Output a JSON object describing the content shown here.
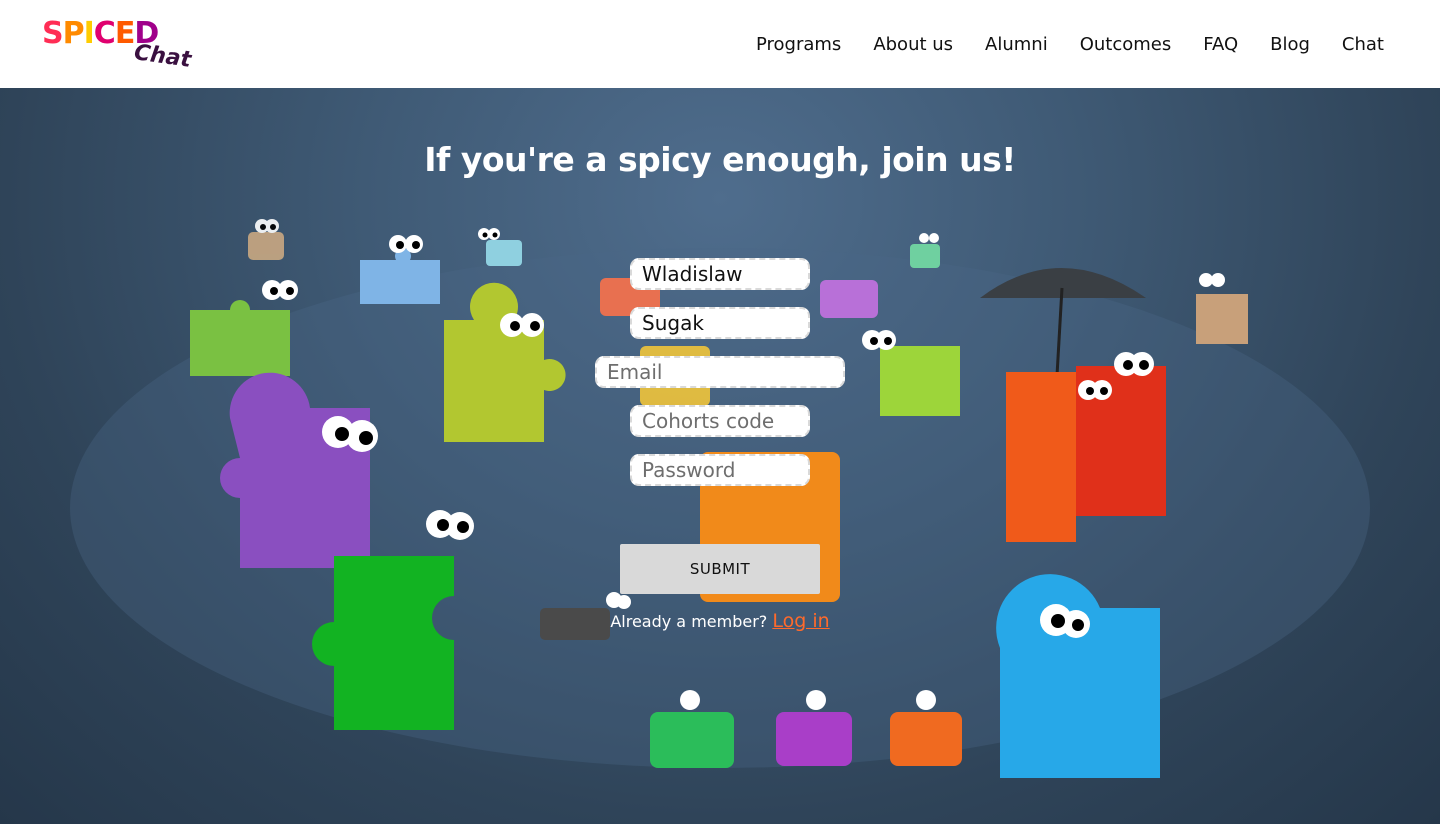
{
  "header": {
    "logo": {
      "word": "SPICED",
      "sub": "Chat"
    },
    "nav": [
      "Programs",
      "About us",
      "Alumni",
      "Outcomes",
      "FAQ",
      "Blog",
      "Chat"
    ]
  },
  "hero": {
    "title": "If you're a spicy enough, join us!"
  },
  "form": {
    "first_name": {
      "value": "Wladislaw"
    },
    "last_name": {
      "value": "Sugak"
    },
    "email": {
      "placeholder": "Email"
    },
    "cohorts_code": {
      "placeholder": "Cohorts code"
    },
    "password": {
      "placeholder": "Password"
    },
    "submit_label": "SUBMIT",
    "member_text": "Already a member?",
    "login_label": "Log in"
  },
  "colors": {
    "link": "#ff6a2b",
    "background": "#3f5a75",
    "button": "#d9d9d9"
  }
}
